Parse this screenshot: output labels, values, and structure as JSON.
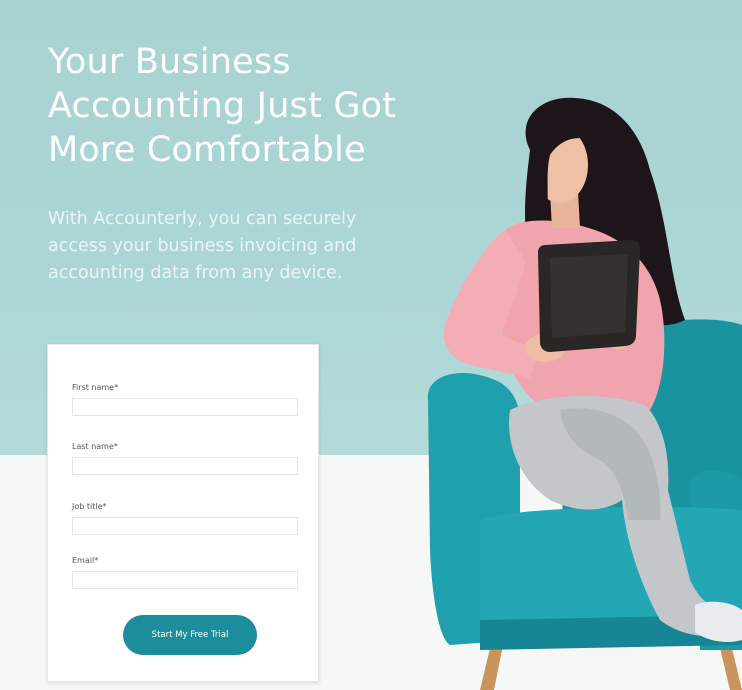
{
  "hero": {
    "headline": "Your Business Accounting Just Got More Comfortable",
    "subtext": "With Accounterly, you can securely access your business invoicing and accounting data from any device."
  },
  "form": {
    "fields": [
      {
        "label": "First name*",
        "value": "",
        "placeholder": ""
      },
      {
        "label": "Last name*",
        "value": "",
        "placeholder": ""
      },
      {
        "label": "Job title*",
        "value": "",
        "placeholder": ""
      },
      {
        "label": "Email*",
        "value": "",
        "placeholder": ""
      }
    ],
    "submit_label": "Start My Free Trial"
  },
  "colors": {
    "hero_background": "#acd6d5",
    "button": "#1b8d9b",
    "chair": "#1fa0ae"
  },
  "illustration": {
    "icon": "woman-with-tablet-on-armchair-icon"
  }
}
